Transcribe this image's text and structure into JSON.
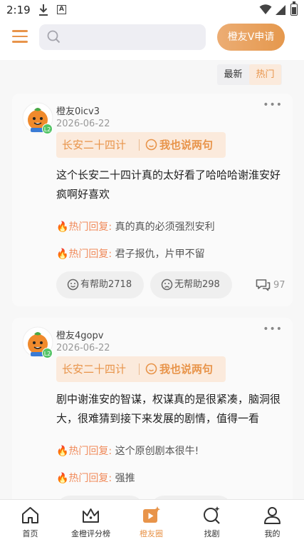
{
  "status_bar": {
    "time": "2:19"
  },
  "header": {
    "search_placeholder": "",
    "apply_button": "橙友V申请"
  },
  "sort": {
    "latest": "最新",
    "hot": "热门",
    "active": "hot"
  },
  "posts": [
    {
      "username": "橙友0icv3",
      "date": "2026-06-22",
      "level": "L2",
      "show": "长安二十四计",
      "say_label": "我也说两句",
      "content": "这个长安二十四计真的太好看了哈哈哈谢淮安好疯啊好喜欢",
      "hot_replies": [
        {
          "label": "热门回复:",
          "text": "真的真的必须强烈安利"
        },
        {
          "label": "热门回复:",
          "text": "君子报仇，片甲不留"
        }
      ],
      "helpful": "有帮助2718",
      "unhelpful": "无帮助298",
      "comments": "97"
    },
    {
      "username": "橙友4gopv",
      "date": "2026-06-22",
      "level": "L2",
      "show": "长安二十四计",
      "say_label": "我也说两句",
      "content": "剧中谢淮安的智谋，权谋真的是很紧凑，脑洞很大，很难猜到接下来发展的剧情，值得一看",
      "hot_replies": [
        {
          "label": "热门回复:",
          "text": "这个原创剧本很牛!"
        },
        {
          "label": "热门回复:",
          "text": "强推"
        }
      ]
    }
  ],
  "nav": [
    {
      "label": "首页",
      "icon": "home-icon"
    },
    {
      "label": "金橙评分榜",
      "icon": "crown-icon"
    },
    {
      "label": "橙友圈",
      "icon": "play-sparkle-icon",
      "active": true
    },
    {
      "label": "找剧",
      "icon": "search-sparkle-icon"
    },
    {
      "label": "我的",
      "icon": "person-icon"
    }
  ],
  "colors": {
    "accent": "#e8944a",
    "hot_fire": "#f0572e",
    "badge_green": "#53c466"
  }
}
